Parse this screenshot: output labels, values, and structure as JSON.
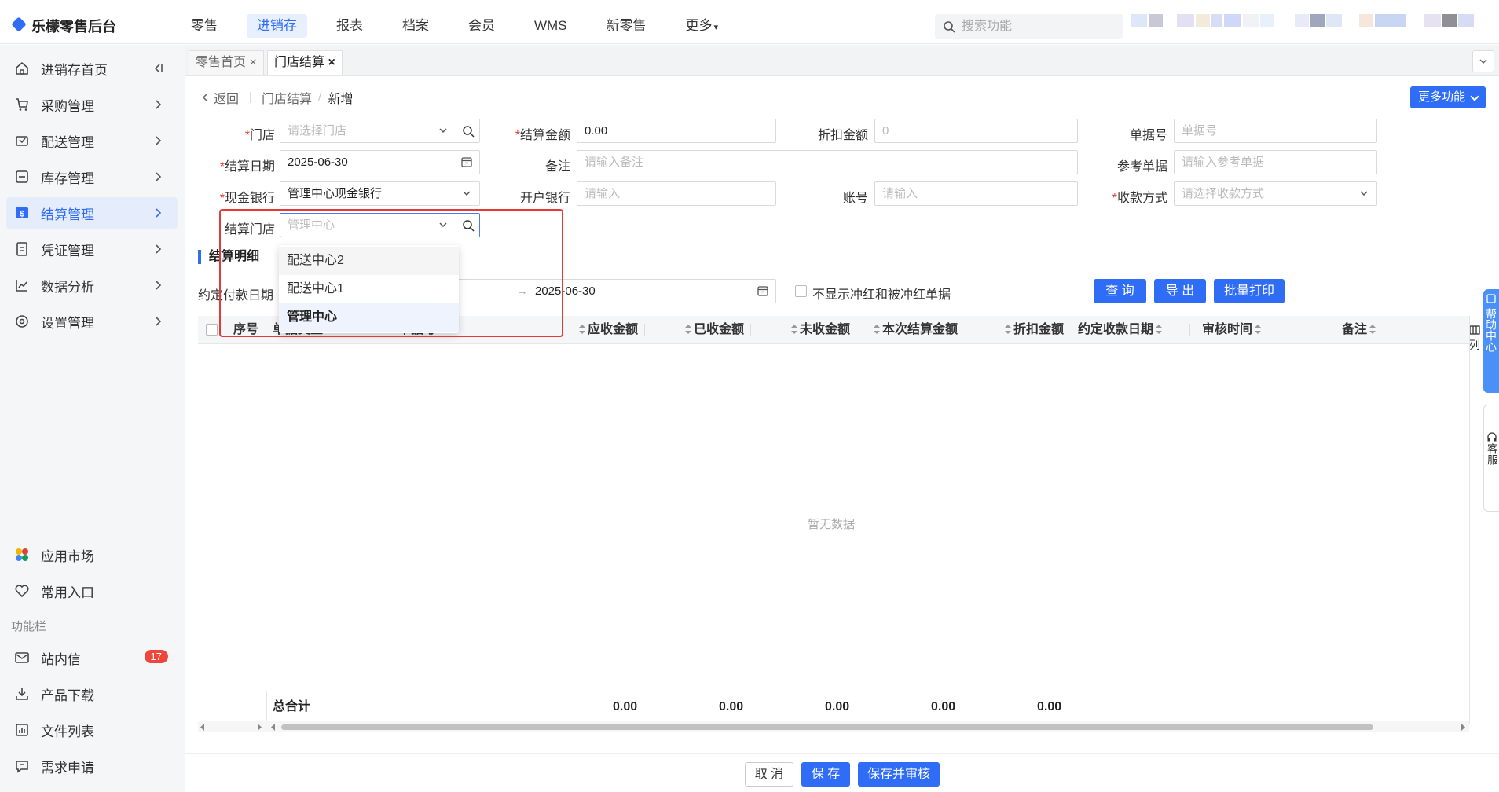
{
  "app": {
    "title": "乐檬零售后台"
  },
  "topnav": [
    {
      "label": "零售"
    },
    {
      "label": "进销存",
      "active": true
    },
    {
      "label": "报表"
    },
    {
      "label": "档案"
    },
    {
      "label": "会员"
    },
    {
      "label": "WMS"
    },
    {
      "label": "新零售"
    },
    {
      "label": "更多"
    }
  ],
  "search": {
    "placeholder": "搜索功能"
  },
  "sidebar": {
    "items": [
      {
        "label": "进销存首页",
        "icon": "home-icon"
      },
      {
        "label": "采购管理",
        "icon": "cart-icon"
      },
      {
        "label": "配送管理",
        "icon": "delivery-icon"
      },
      {
        "label": "库存管理",
        "icon": "stock-icon"
      },
      {
        "label": "结算管理",
        "icon": "settlement-icon",
        "active": true
      },
      {
        "label": "凭证管理",
        "icon": "voucher-icon"
      },
      {
        "label": "数据分析",
        "icon": "chart-icon"
      },
      {
        "label": "设置管理",
        "icon": "settings-icon"
      }
    ],
    "extras": [
      {
        "label": "应用市场"
      },
      {
        "label": "常用入口"
      }
    ],
    "function_bar_label": "功能栏",
    "function_items": [
      {
        "label": "站内信",
        "badge": "17"
      },
      {
        "label": "产品下载"
      },
      {
        "label": "文件列表"
      },
      {
        "label": "需求申请"
      }
    ]
  },
  "tabs": [
    {
      "label": "零售首页",
      "close": "×"
    },
    {
      "label": "门店结算",
      "close": "×",
      "active": true
    }
  ],
  "breadcrumb": {
    "back": "返回",
    "parent": "门店结算",
    "sep": "/",
    "current": "新增"
  },
  "more_functions": "更多功能",
  "form": {
    "store": {
      "label": "门店",
      "placeholder": "请选择门店"
    },
    "settle_amount": {
      "label": "结算金额",
      "value": "0.00"
    },
    "discount_amount": {
      "label": "折扣金额",
      "placeholder": "0"
    },
    "doc_no": {
      "label": "单据号",
      "placeholder": "单据号"
    },
    "settle_date": {
      "label": "结算日期",
      "value": "2025-06-30"
    },
    "remark": {
      "label": "备注",
      "placeholder": "请输入备注"
    },
    "ref_doc": {
      "label": "参考单据",
      "placeholder": "请输入参考单据"
    },
    "cash_bank": {
      "label": "现金银行",
      "value": "管理中心现金银行"
    },
    "open_bank": {
      "label": "开户银行",
      "placeholder": "请输入"
    },
    "account": {
      "label": "账号",
      "placeholder": "请输入"
    },
    "pay_method": {
      "label": "收款方式",
      "placeholder": "请选择收款方式"
    },
    "settle_store": {
      "label": "结算门店",
      "placeholder": "管理中心"
    }
  },
  "dropdown": {
    "options": [
      "配送中心2",
      "配送中心1",
      "管理中心"
    ],
    "selected": "管理中心"
  },
  "detail": {
    "title": "结算明细",
    "date_label": "约定付款日期",
    "date_to": "2025-06-30",
    "arrow": "→",
    "hide_red_label": "不显示冲红和被冲红单据",
    "buttons": {
      "query": "查 询",
      "export": "导 出",
      "batch_print": "批量打印"
    }
  },
  "table": {
    "columns": [
      "序号",
      "单据类型",
      "单据号",
      "应收金额",
      "已收金额",
      "未收金额",
      "本次结算金额",
      "折扣金额",
      "约定收款日期",
      "审核时间",
      "备注"
    ],
    "empty": "暂无数据",
    "total_label": "总合计",
    "totals": [
      "0.00",
      "0.00",
      "0.00",
      "0.00",
      "0.00"
    ],
    "col_setting": "列"
  },
  "footer": {
    "cancel": "取 消",
    "save": "保 存",
    "save_audit": "保存并审核"
  },
  "right_dock": {
    "help": "帮助中心",
    "service": "客服"
  }
}
